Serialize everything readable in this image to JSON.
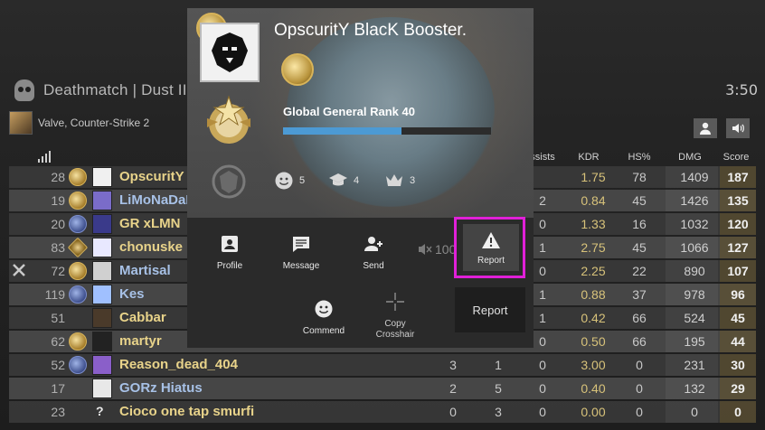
{
  "header": {
    "mode_title": "Deathmatch | Dust II",
    "timer": "3:50"
  },
  "server": {
    "name": "Valve, Counter-Strike 2"
  },
  "columns": {
    "assists": "ssists",
    "kdr": "KDR",
    "hs": "HS%",
    "dmg": "DMG",
    "score": "Score"
  },
  "players": [
    {
      "ping": "28",
      "name": "OpscuritY",
      "team": "t",
      "badge": "gold",
      "kills": "",
      "deaths": "",
      "assists": "",
      "kdr": "1.75",
      "hs": "78",
      "dmg": "1409",
      "score": "187"
    },
    {
      "ping": "19",
      "name": "LiMoNaDaE",
      "team": "ct",
      "badge": "gold",
      "kills": "",
      "deaths": "",
      "assists": "2",
      "kdr": "0.84",
      "hs": "45",
      "dmg": "1426",
      "score": "135"
    },
    {
      "ping": "20",
      "name": "GR xLMN",
      "team": "t",
      "badge": "blue",
      "kills": "",
      "deaths": "",
      "assists": "0",
      "kdr": "1.33",
      "hs": "16",
      "dmg": "1032",
      "score": "120"
    },
    {
      "ping": "83",
      "name": "chonuske",
      "team": "t",
      "badge": "star",
      "kills": "",
      "deaths": "",
      "assists": "1",
      "kdr": "2.75",
      "hs": "45",
      "dmg": "1066",
      "score": "127"
    },
    {
      "ping": "72",
      "name": "Martisal",
      "team": "ct",
      "badge": "gold",
      "kills": "",
      "deaths": "",
      "assists": "0",
      "kdr": "2.25",
      "hs": "22",
      "dmg": "890",
      "score": "107"
    },
    {
      "ping": "119",
      "name": "Kes",
      "team": "ct",
      "badge": "blue",
      "kills": "",
      "deaths": "",
      "assists": "1",
      "kdr": "0.88",
      "hs": "37",
      "dmg": "978",
      "score": "96"
    },
    {
      "ping": "51",
      "name": "Cabbar",
      "team": "t",
      "badge": "none",
      "kills": "",
      "deaths": "",
      "assists": "1",
      "kdr": "0.42",
      "hs": "66",
      "dmg": "524",
      "score": "45"
    },
    {
      "ping": "62",
      "name": "martyr",
      "team": "t",
      "badge": "gold",
      "kills": "",
      "deaths": "",
      "assists": "0",
      "kdr": "0.50",
      "hs": "66",
      "dmg": "195",
      "score": "44"
    },
    {
      "ping": "52",
      "name": "Reason_dead_404",
      "team": "t",
      "badge": "blue",
      "kills": "3",
      "deaths": "1",
      "assists": "0",
      "kdr": "3.00",
      "hs": "0",
      "dmg": "231",
      "score": "30"
    },
    {
      "ping": "17",
      "name": "GORz Hiatus",
      "team": "ct",
      "badge": "none",
      "kills": "2",
      "deaths": "5",
      "assists": "0",
      "kdr": "0.40",
      "hs": "0",
      "dmg": "132",
      "score": "29"
    },
    {
      "ping": "23",
      "name": "Cioco one tap smurfi",
      "team": "t",
      "badge": "none",
      "kills": "0",
      "deaths": "3",
      "assists": "0",
      "kdr": "0.00",
      "hs": "0",
      "dmg": "0",
      "score": "0"
    }
  ],
  "popup": {
    "player_name": "OpscuritY BlacK Booster.",
    "rank_label": "Global General Rank 40",
    "xp_progress": 0.57,
    "stats": {
      "friendly": "5",
      "teacher": "4",
      "leader": "3"
    },
    "actions": {
      "profile": "Profile",
      "message": "Message",
      "send": "Send",
      "volume": "100",
      "report": "Report",
      "commend": "Commend",
      "copy_crosshair": "Copy\nCrosshair"
    },
    "tooltip": "Report"
  },
  "colors": {
    "accent": "#4c9ad4",
    "highlight": "#e020d8",
    "t_name": "#e8d38a",
    "ct_name": "#a7c1e6"
  }
}
